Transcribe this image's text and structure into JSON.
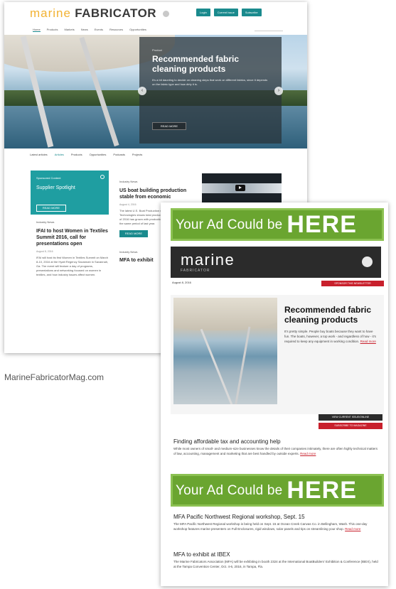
{
  "site": {
    "logo_marine": "marine",
    "logo_fabricator": "FABRICATOR",
    "header_buttons": [
      "Login",
      "Current Issue",
      "Subscribe"
    ],
    "nav": [
      "Home",
      "Products",
      "Markets",
      "News",
      "Events",
      "Resources",
      "Opportunities"
    ],
    "hero": {
      "kicker": "Product",
      "title": "Recommended fabric cleaning products",
      "body": "It’s a bit daunting to decide on cleaning steps that work on different fabrics, since it depends on the fabric type and how dirty it is.",
      "button": "READ MORE",
      "prev": "‹",
      "next": "›"
    },
    "tabs": [
      "Latest articles",
      "Articles",
      "Products",
      "Opportunities",
      "Podcasts",
      "Projects"
    ],
    "col1": {
      "box_kicker": "Sponsored Content",
      "box_title": "Supplier Spotlight",
      "box_button": "READ MORE",
      "kicker": "Industry News",
      "title": "IFAI to host Women in Textiles Summit 2016, call for presentations open",
      "date": "August 8, 2016",
      "body": "IFAI will host its first Women in Textiles Summit on March 8-10, 2016 at the Hyatt Regency Savannah in Savannah, Ga. The event will feature a day of programs, presentations and networking focused on women in textiles, and how industry issues affect women."
    },
    "col2": {
      "kicker": "Industry News",
      "title": "US boat building production stable from economic",
      "date": "August 4, 2016",
      "body": "The latest U.S. Boat Production report from Info-Link Technologies shows total production in the first quarter of 2016 has grown with production stable compared with the same period of last year.",
      "button": "READ MORE",
      "kicker2": "Industry News",
      "title2": "MFA to exhibit"
    }
  },
  "site_caption": "MarineFabricatorMag.com",
  "newsletter": {
    "ad_small": "Your Ad Could be",
    "ad_big": "HERE",
    "logo": "marine",
    "logo_sub": "FABRICATOR",
    "date": "August 8, 2016",
    "header_button": "SPONSOR THIS NEWSLETTER",
    "feature": {
      "title": "Recommended fabric cleaning products",
      "body": "It’s pretty simple. People buy boats because they want to have fun. The boats, however, a top work - and regardless of how - it’s required to keep any equipment in working condition.",
      "link": "Read more"
    },
    "btn_current_issue": "VIEW CURRENT ISSUE/ONLINE",
    "btn_subscribe": "SUBSCRIBE TO MAGAZINE",
    "stories": [
      {
        "title": "Finding affordable tax and accounting help",
        "body": "While most owners of small- and medium-size businesses know the details of their companies intimately, there are often highly technical matters of law, accounting, management and marketing that are best handled by outside experts.",
        "link": "Read more"
      },
      {
        "title": "MFA Pacific Northwest Regional workshop, Sept. 15",
        "body": "The MFA Pacific Northwest Regional workshop is being held on Sept. 15 at Ocean Creek Canvas Co. in Bellingham, Wash. This one-day workshop features marine presenters on Full Enclosures, rigid windows, solar panels and tips on streamlining your shop.",
        "link": "Read more"
      },
      {
        "title": "MFA to exhibit at IBEX",
        "body": "The Marine Fabricators Association (MFA) will be exhibiting in booth 2324 at the International BoatBuilders’ Exhibition & Conference (IBEX), held at the Tampa Convention Center, Oct. 4-6, 2016, in Tampa, Fla.",
        "link": ""
      }
    ]
  }
}
